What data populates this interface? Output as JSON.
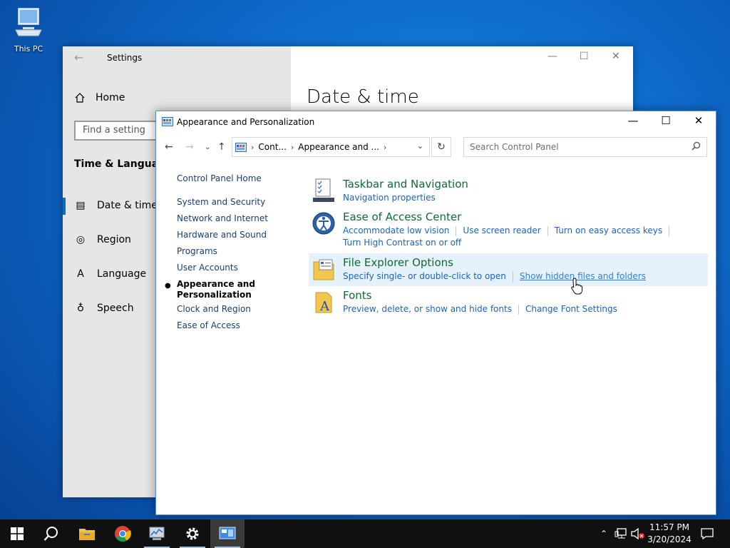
{
  "desktop": {
    "icons": [
      {
        "label": "This PC",
        "icon": "this-pc-icon"
      }
    ]
  },
  "settings_window": {
    "title": "Settings",
    "home_label": "Home",
    "search_placeholder": "Find a setting",
    "section": "Time & Language",
    "nav": [
      {
        "label": "Date & time",
        "icon": "calendar-clock-icon",
        "active": true
      },
      {
        "label": "Region",
        "icon": "globe-icon"
      },
      {
        "label": "Language",
        "icon": "language-icon"
      },
      {
        "label": "Speech",
        "icon": "microphone-icon"
      }
    ],
    "heading": "Date & time"
  },
  "cp_window": {
    "title": "Appearance and Personalization",
    "address": {
      "crumbs": [
        "Cont...",
        "Appearance and ..."
      ]
    },
    "search_placeholder": "Search Control Panel",
    "left_nav": {
      "home": "Control Panel Home",
      "items": [
        "System and Security",
        "Network and Internet",
        "Hardware and Sound",
        "Programs",
        "User Accounts",
        "Appearance and Personalization",
        "Clock and Region",
        "Ease of Access"
      ],
      "current_index": 5
    },
    "categories": [
      {
        "title": "Taskbar and Navigation",
        "icon": "taskbar-icon",
        "links": [
          "Navigation properties"
        ]
      },
      {
        "title": "Ease of Access Center",
        "icon": "ease-of-access-icon",
        "links": [
          "Accommodate low vision",
          "Use screen reader",
          "Turn on easy access keys"
        ],
        "links2": [
          "Turn High Contrast on or off"
        ]
      },
      {
        "title": "File Explorer Options",
        "icon": "folder-options-icon",
        "highlighted": true,
        "links": [
          "Specify single- or double-click to open",
          "Show hidden files and folders"
        ]
      },
      {
        "title": "Fonts",
        "icon": "fonts-icon",
        "links": [
          "Preview, delete, or show and hide fonts",
          "Change Font Settings"
        ]
      }
    ]
  },
  "taskbar": {
    "apps": [
      "start-icon",
      "search-icon",
      "file-explorer-icon",
      "chrome-icon",
      "control-panel-icon",
      "settings-icon",
      "personalization-icon"
    ],
    "clock": {
      "time": "11:57 PM",
      "date": "3/20/2024"
    }
  },
  "colors": {
    "accent": "#0a6fc2",
    "link": "#1e63b4",
    "category_title": "#0e6b34",
    "highlight": "#e5f1fb"
  }
}
